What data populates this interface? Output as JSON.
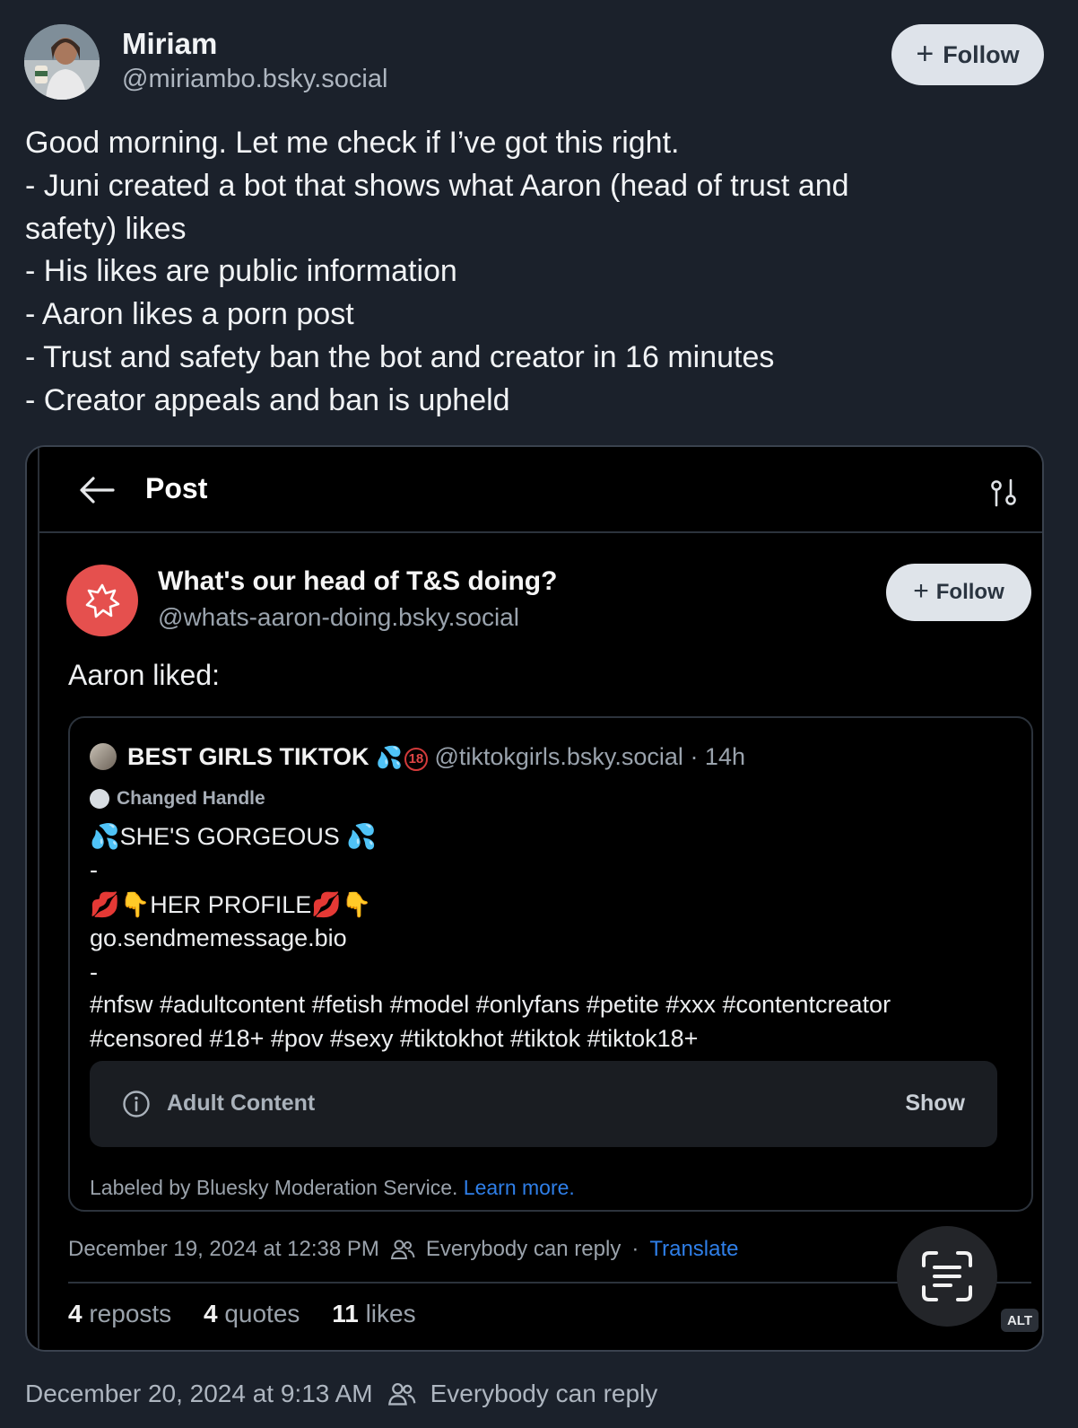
{
  "author": {
    "name": "Miriam",
    "handle": "@miriambo.bsky.social",
    "follow_label": "Follow"
  },
  "post": {
    "lines": [
      "Good morning. Let me check if I’ve got this right.",
      "- Juni created a bot that shows what Aaron (head of trust and",
      "safety) likes",
      "- His likes are public information",
      "- Aaron likes a porn post",
      "- Trust and safety ban the bot and creator in 16 minutes",
      "- Creator appeals and ban is upheld"
    ],
    "timestamp": "December 20, 2024 at 9:13 AM",
    "reply_setting": "Everybody can reply"
  },
  "screenshot": {
    "header_title": "Post",
    "bot": {
      "name": "What's our head of T&S doing?",
      "handle": "@whats-aaron-doing.bsky.social",
      "follow_label": "Follow"
    },
    "intro": "Aaron liked:",
    "quoted": {
      "name": "BEST GIRLS TIKTOK",
      "name_emoji": "💦",
      "badge": "18",
      "handle": "@tiktokgirls.bsky.social",
      "age": "· 14h",
      "changed_handle": "Changed Handle",
      "lines": [
        "💦SHE'S GORGEOUS 💦",
        "-",
        "💋👇HER PROFILE💋👇",
        "go.sendmemessage.bio",
        "-",
        "#nfsw #adultcontent #fetish #model #onlyfans #petite #xxx #contentcreator",
        "#censored #18+ #pov #sexy #tiktokhot #tiktok #tiktok18+"
      ],
      "adult_label": "Adult Content",
      "show_label": "Show",
      "labeled_by": "Labeled by Bluesky Moderation Service.",
      "learn_more": "Learn more."
    },
    "meta": {
      "timestamp": "December 19, 2024 at 12:38 PM",
      "reply_setting": "Everybody can reply",
      "separator": "·",
      "translate": "Translate"
    },
    "stats": {
      "reposts_count": "4",
      "reposts_label": "reposts",
      "quotes_count": "4",
      "quotes_label": "quotes",
      "likes_count": "11",
      "likes_label": "likes"
    },
    "alt_badge": "ALT"
  },
  "colors": {
    "background": "#1b212b",
    "link": "#2f7fe8",
    "bot_avatar": "#e5504e"
  },
  "icons": [
    "plus-icon",
    "back-arrow-icon",
    "sort-icon",
    "starburst-icon",
    "info-icon",
    "people-icon",
    "text-scan-icon"
  ]
}
